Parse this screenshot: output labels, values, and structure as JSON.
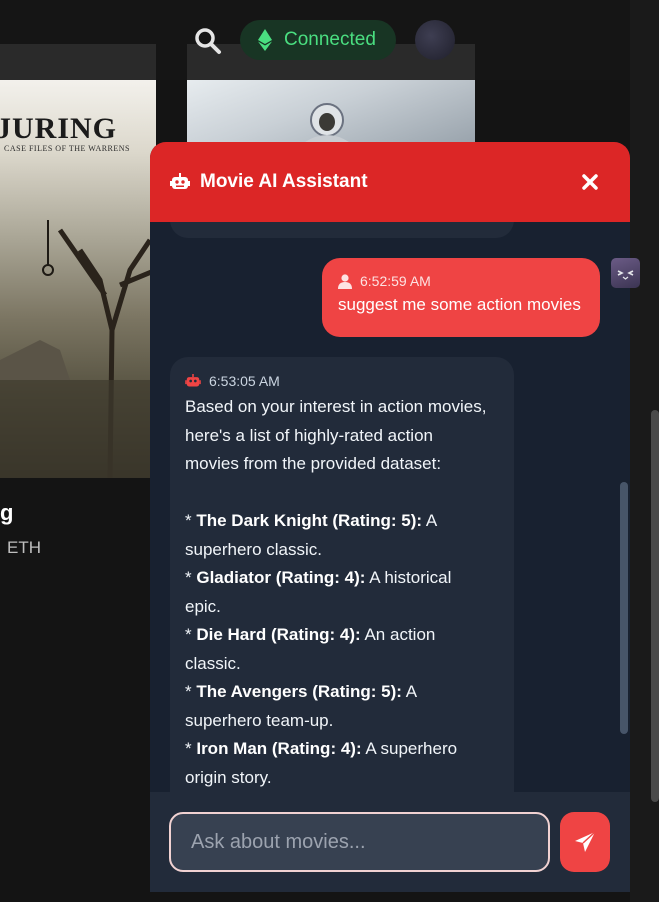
{
  "background": {
    "poster_title": "JURING",
    "poster_subtitle": "CASE FILES OF THE WARRENS",
    "movie_title": "g",
    "movie_price": "ETH"
  },
  "header": {
    "status_label": "Connected",
    "status_color": "#4ade80",
    "search_icon": "search-icon",
    "wallet_icon": "ethereum-icon"
  },
  "chat": {
    "title": "Movie AI Assistant",
    "accent_color": "#dc2626",
    "user_message": {
      "time": "6:52:59 AM",
      "text": "suggest me some action movies"
    },
    "bot_message": {
      "time": "6:53:05 AM",
      "intro": [
        "Based on your interest in action movies,",
        "here's a list of highly-rated action",
        "movies from the provided dataset:"
      ],
      "items": [
        {
          "bold": "The Dark Knight (Rating: 5):",
          "desc_line1": " A",
          "desc_line2": "superhero classic."
        },
        {
          "bold": "Gladiator (Rating: 4):",
          "desc_line1": " A historical",
          "desc_line2": "epic."
        },
        {
          "bold": "Die Hard (Rating: 4):",
          "desc_line1": " An action",
          "desc_line2": "classic."
        },
        {
          "bold": "The Avengers (Rating: 5):",
          "desc_line1": " A",
          "desc_line2": "superhero team-up."
        },
        {
          "bold": "Iron Man (Rating: 4):",
          "desc_line1": " A superhero",
          "desc_line2": "origin story."
        }
      ],
      "bullet": "* "
    },
    "input_placeholder": "Ask about movies...",
    "input_value": ""
  }
}
